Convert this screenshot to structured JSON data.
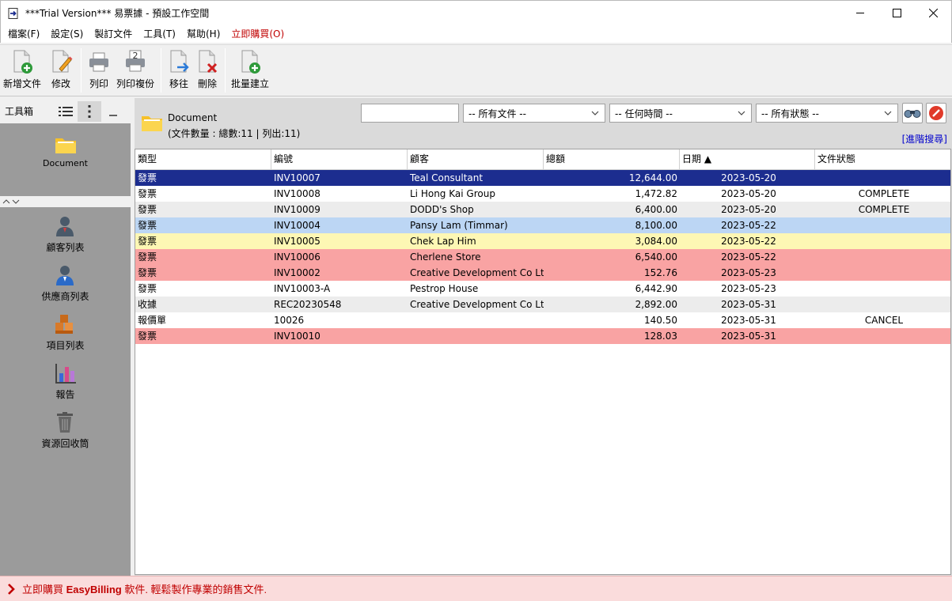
{
  "window": {
    "title": "***Trial Version*** 易票據 - 預設工作空間"
  },
  "menu": [
    {
      "label": "檔案(F)",
      "style": "normal"
    },
    {
      "label": "設定(S)",
      "style": "normal"
    },
    {
      "label": "製訂文件",
      "style": "normal"
    },
    {
      "label": "工具(T)",
      "style": "normal"
    },
    {
      "label": "幫助(H)",
      "style": "normal"
    },
    {
      "label": "立即購買(O)",
      "style": "buy"
    }
  ],
  "toolbar": {
    "new_label": "新增文件",
    "edit_label": "修改",
    "print_label": "列印",
    "print_copies_label": "列印複份",
    "move_label": "移往",
    "delete_label": "刪除",
    "batch_label": "批量建立"
  },
  "toolbox": {
    "title": "工具箱",
    "top_items": [
      {
        "label": "Document",
        "icon": "folder-icon"
      }
    ],
    "bottom_items": [
      {
        "label": "顧客列表",
        "icon": "customer-icon"
      },
      {
        "label": "供應商列表",
        "icon": "supplier-icon"
      },
      {
        "label": "項目列表",
        "icon": "items-icon"
      },
      {
        "label": "報告",
        "icon": "report-icon"
      },
      {
        "label": "資源回收筒",
        "icon": "recycle-bin-icon"
      }
    ]
  },
  "document_panel": {
    "title": "Document",
    "count_text": "(文件數量 : 總數:11 | 列出:11)",
    "search_value": "",
    "filter_type": "-- 所有文件 --",
    "filter_time": "-- 任何時間  --",
    "filter_status": "-- 所有狀態 --",
    "advanced_search": "[進階搜尋]"
  },
  "table": {
    "headers": [
      "類型",
      "編號",
      "顧客",
      "總額",
      "日期 ▲",
      "文件狀態"
    ],
    "rows": [
      {
        "type": "發票",
        "number": "INV10007",
        "customer": "Teal Consultant",
        "total": "12,644.00",
        "date": "2023-05-20",
        "status": "",
        "bg": "#1c2d8f",
        "fg": "#ffffff"
      },
      {
        "type": "發票",
        "number": "INV10008",
        "customer": "Li Hong Kai Group",
        "total": "1,472.82",
        "date": "2023-05-20",
        "status": "COMPLETE",
        "bg": "#ffffff",
        "fg": "#000000"
      },
      {
        "type": "發票",
        "number": "INV10009",
        "customer": "DODD's Shop",
        "total": "6,400.00",
        "date": "2023-05-20",
        "status": "COMPLETE",
        "bg": "#ececec",
        "fg": "#000000"
      },
      {
        "type": "發票",
        "number": "INV10004",
        "customer": "Pansy Lam (Timmar)",
        "total": "8,100.00",
        "date": "2023-05-22",
        "status": "",
        "bg": "#bcd6f4",
        "fg": "#000000"
      },
      {
        "type": "發票",
        "number": "INV10005",
        "customer": "Chek Lap Him",
        "total": "3,084.00",
        "date": "2023-05-22",
        "status": "",
        "bg": "#fdf7b4",
        "fg": "#000000"
      },
      {
        "type": "發票",
        "number": "INV10006",
        "customer": "Cherlene Store",
        "total": "6,540.00",
        "date": "2023-05-22",
        "status": "",
        "bg": "#f9a3a3",
        "fg": "#000000"
      },
      {
        "type": "發票",
        "number": "INV10002",
        "customer": "Creative Development Co Ltd",
        "total": "152.76",
        "date": "2023-05-23",
        "status": "",
        "bg": "#f9a3a3",
        "fg": "#000000"
      },
      {
        "type": "發票",
        "number": "INV10003-A",
        "customer": "Pestrop House",
        "total": "6,442.90",
        "date": "2023-05-23",
        "status": "",
        "bg": "#ffffff",
        "fg": "#000000"
      },
      {
        "type": "收據",
        "number": "REC20230548",
        "customer": "Creative Development Co Ltd",
        "total": "2,892.00",
        "date": "2023-05-31",
        "status": "",
        "bg": "#ececec",
        "fg": "#000000"
      },
      {
        "type": "報價單",
        "number": "10026",
        "customer": "",
        "total": "140.50",
        "date": "2023-05-31",
        "status": "CANCEL",
        "bg": "#ffffff",
        "fg": "#000000"
      },
      {
        "type": "發票",
        "number": "INV10010",
        "customer": "",
        "total": "128.03",
        "date": "2023-05-31",
        "status": "",
        "bg": "#f9a3a3",
        "fg": "#000000"
      }
    ]
  },
  "status_bar": {
    "prefix": "立即購買 ",
    "brand": "EasyBilling",
    "suffix": " 軟件. 輕鬆製作專業的銷售文件."
  }
}
